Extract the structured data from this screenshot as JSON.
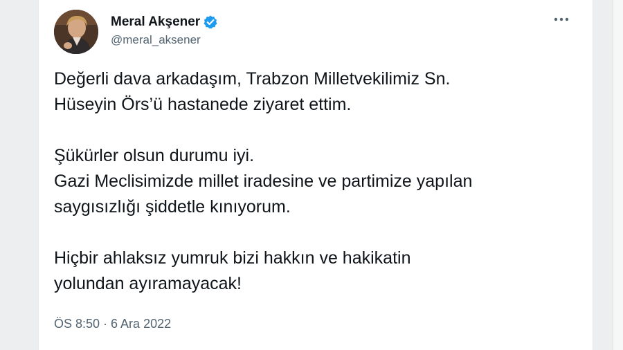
{
  "tweet": {
    "author": {
      "name": "Meral Akşener",
      "handle": "@meral_aksener",
      "verified_icon": "verified-badge-icon",
      "avatar_icon": "profile-avatar"
    },
    "menu_icon": "more-options-icon",
    "text": {
      "line1": "Değerli dava arkadaşım, Trabzon Milletvekilimiz Sn.",
      "line2": "Hüseyin Örs’ü hastanede ziyaret ettim.",
      "line3": "Şükürler olsun durumu iyi.",
      "line4": "Gazi Meclisimizde millet iradesine ve partimize yapılan",
      "line5": "saygısızlığı şiddetle kınıyorum.",
      "line6": "Hiçbir ahlaksız yumruk bizi hakkın ve hakikatin",
      "line7": "yolundan ayıramayacak!"
    },
    "timestamp": "ÖS 8:50 · 6 Ara 2022"
  },
  "colors": {
    "verified": "#1d9bf0",
    "text": "#0f1419",
    "muted": "#536471"
  }
}
